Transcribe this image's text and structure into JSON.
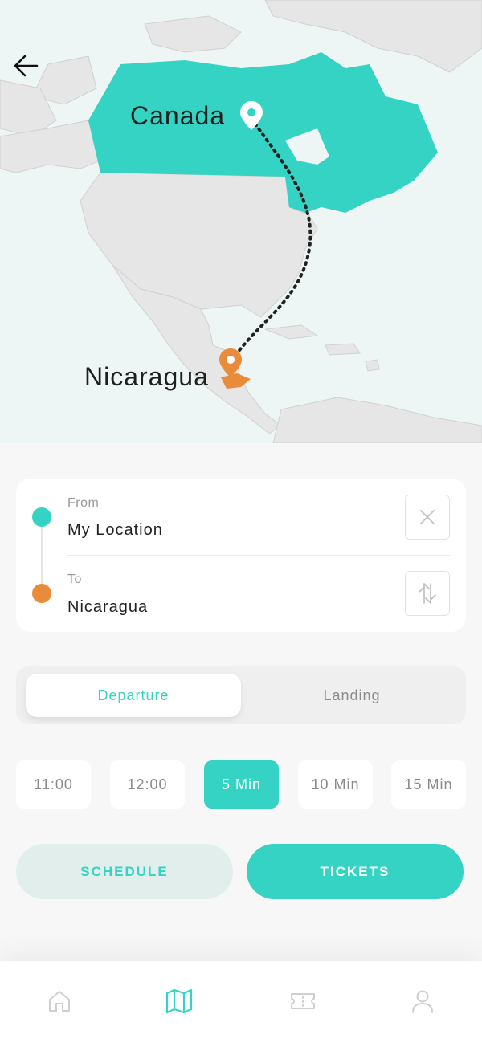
{
  "map": {
    "origin_label": "Canada",
    "destination_label": "Nicaragua",
    "route_color": "#222222",
    "highlight_color": "#34d3c3",
    "destination_color": "#e88c3c"
  },
  "header": {
    "back_icon": "arrow-left-icon"
  },
  "route": {
    "from_label": "From",
    "from_value": "My Location",
    "to_label": "To",
    "to_value": "Nicaragua",
    "clear_icon": "close-icon",
    "swap_icon": "swap-arrows-icon"
  },
  "mode_tabs": {
    "departure": "Departure",
    "landing": "Landing",
    "selected": "Departure"
  },
  "time_options": [
    "11:00",
    "12:00",
    "5 Min",
    "10 Min",
    "15 Min"
  ],
  "selected_time": "5 Min",
  "actions": {
    "schedule": "SCHEDULE",
    "tickets": "TICKETS"
  },
  "bottom_nav": {
    "items": [
      "home-icon",
      "map-icon",
      "ticket-icon",
      "profile-icon"
    ],
    "active": "map-icon"
  },
  "colors": {
    "accent": "#34d3c3",
    "orange": "#e88c3c",
    "muted": "#8a8a8a"
  }
}
